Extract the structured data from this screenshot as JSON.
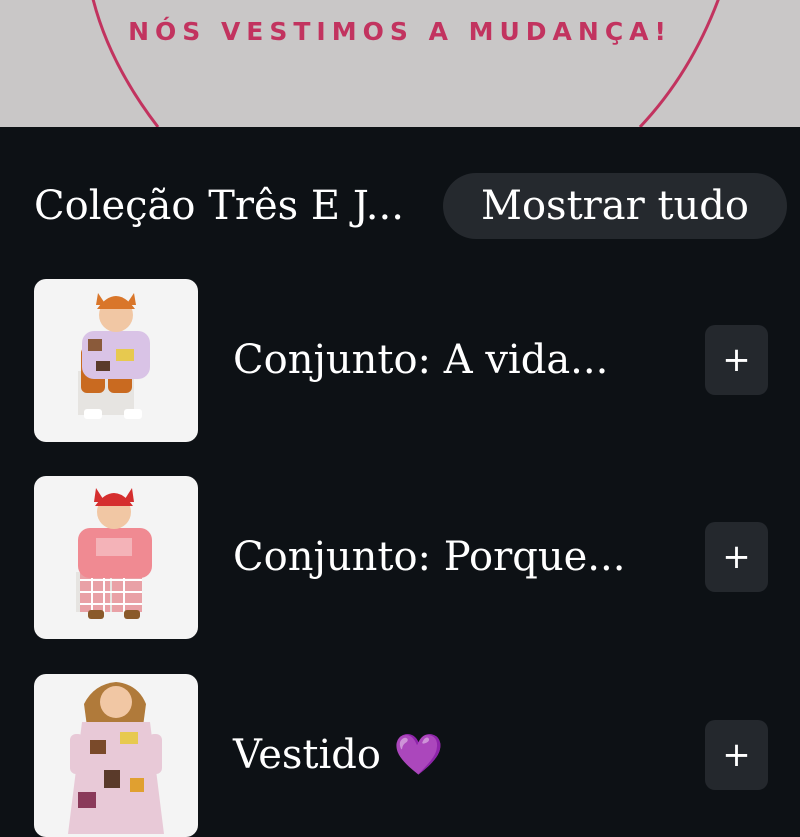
{
  "banner": {
    "tagline": "NÓS VESTIMOS A MUDANÇA!"
  },
  "collection": {
    "title": "Coleção Três E J...",
    "show_all_label": "Mostrar tudo"
  },
  "products": [
    {
      "label": "Conjunto: A vida...",
      "add_label": "+"
    },
    {
      "label": "Conjunto: Porque...",
      "add_label": "+"
    },
    {
      "label": "Vestido 💜",
      "add_label": "+"
    }
  ],
  "colors": {
    "accent": "#c2335f",
    "background": "#0d1115",
    "button": "#25292e"
  }
}
